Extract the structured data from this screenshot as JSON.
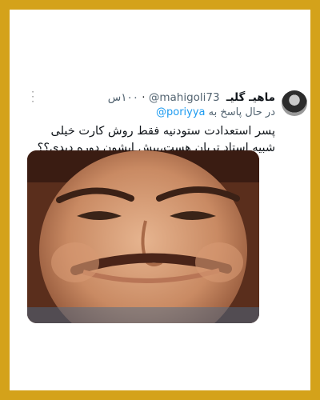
{
  "tweet": {
    "display_name": "ماهیـ گلیـ",
    "handle": "@mahigoli73",
    "timestamp": "۱۰۰س",
    "more_icon": "more-vertical-icon",
    "reply_prefix": "در حال پاسخ به",
    "reply_mention": "@poriyya",
    "text": "پسر استعدادت ستودنیه فقط روش کارت خیلی شبیه استاد تریان هست،پیش ایشون دوره دیدی؟؟",
    "media_description": ""
  },
  "colors": {
    "frame": "#d4a21a",
    "card": "#ffffff",
    "mention": "#1d9bf0",
    "secondary_text": "#536471"
  }
}
